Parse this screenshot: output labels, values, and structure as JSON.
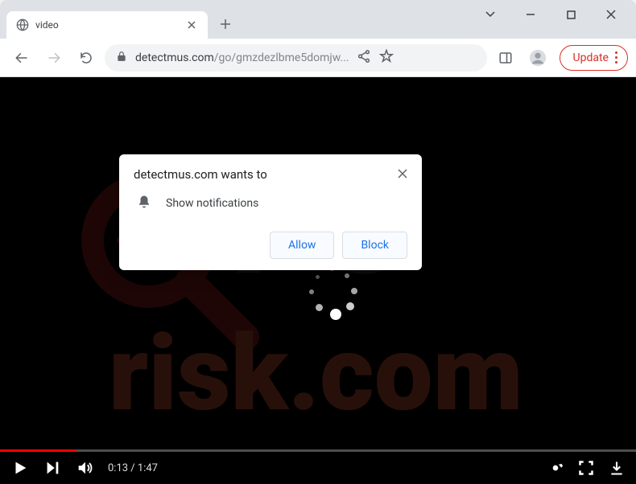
{
  "tab": {
    "title": "video"
  },
  "address": {
    "domain": "detectmus.com",
    "path": "/go/gmzdezlbme5domjw..."
  },
  "toolbar": {
    "update_label": "Update"
  },
  "notification": {
    "title": "detectmus.com wants to",
    "message": "Show notifications",
    "allow_label": "Allow",
    "block_label": "Block"
  },
  "video": {
    "current_time": "0:13",
    "duration": "1:47",
    "progress_percent": 12,
    "time_display": "0:13 / 1:47"
  },
  "watermark": {
    "line1": "PC",
    "line2": "risk.com"
  }
}
